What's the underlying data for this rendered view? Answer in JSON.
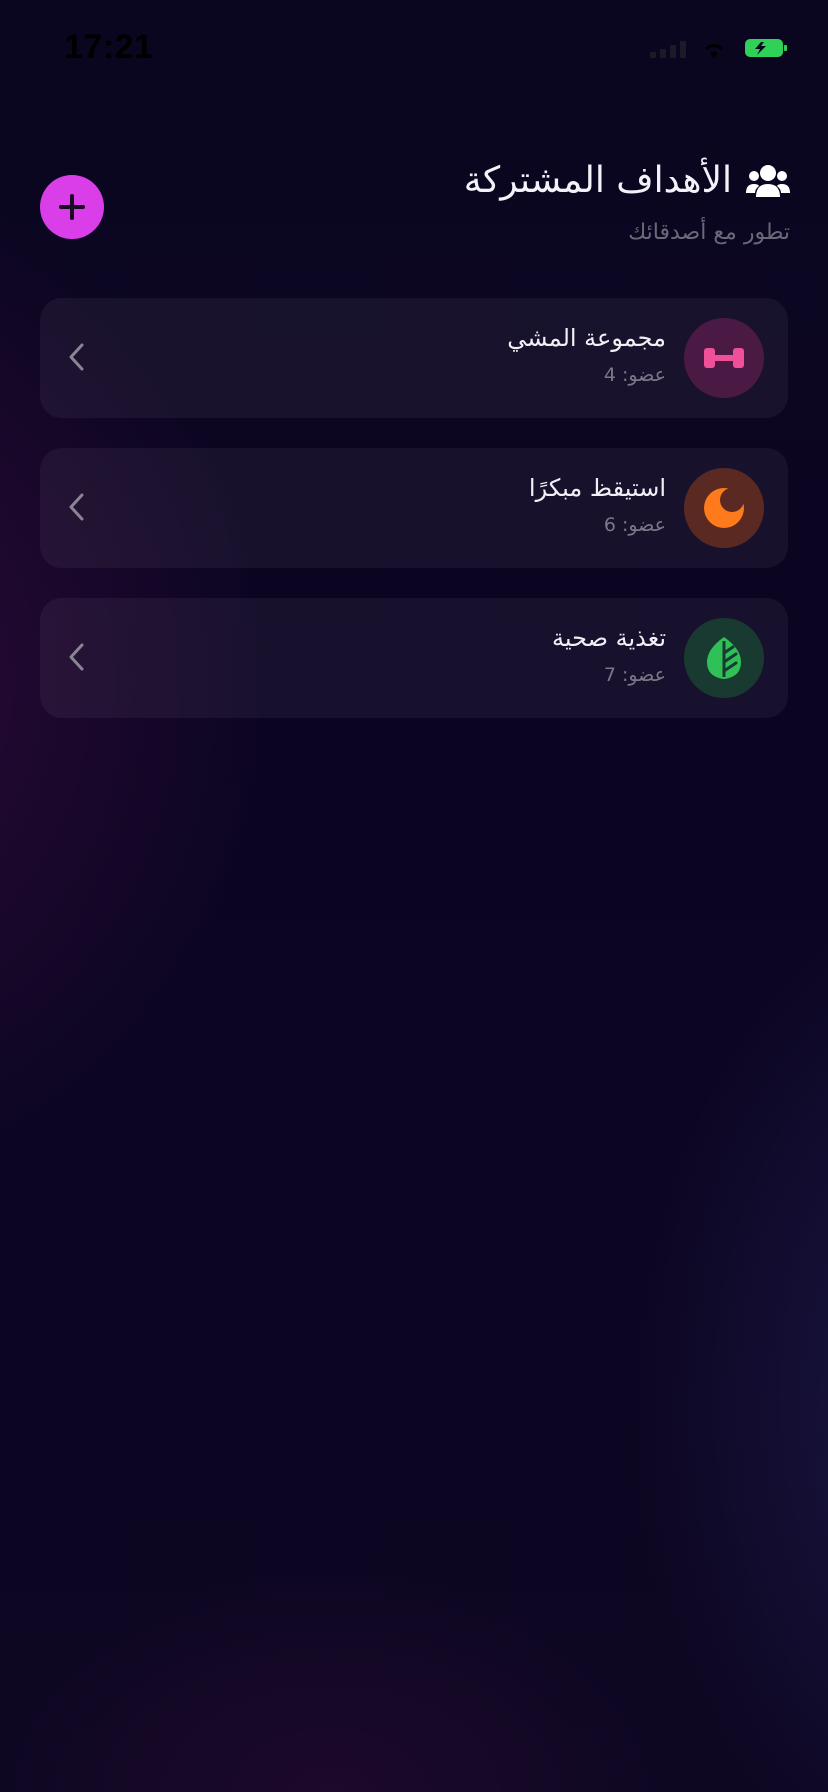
{
  "status_bar": {
    "time": "17:21",
    "battery_color": "#30d158"
  },
  "header": {
    "title": "الأهداف المشتركة",
    "subtitle": "تطور مع أصدقائك",
    "title_icon": "group-icon",
    "add_icon": "plus-icon",
    "accent_color": "#d93ee8"
  },
  "groups": [
    {
      "name": "مجموعة المشي",
      "members": "عضو: 4",
      "icon": "dumbbell-icon",
      "icon_color": "#f0509a",
      "icon_bg": "#4a1a44"
    },
    {
      "name": "استيقظ مبكرًا",
      "members": "عضو: 6",
      "icon": "moon-icon",
      "icon_color": "#ff7a1a",
      "icon_bg": "#5a2a22"
    },
    {
      "name": "تغذية صحية",
      "members": "عضو: 7",
      "icon": "leaf-icon",
      "icon_color": "#30c058",
      "icon_bg": "#183a30"
    }
  ]
}
